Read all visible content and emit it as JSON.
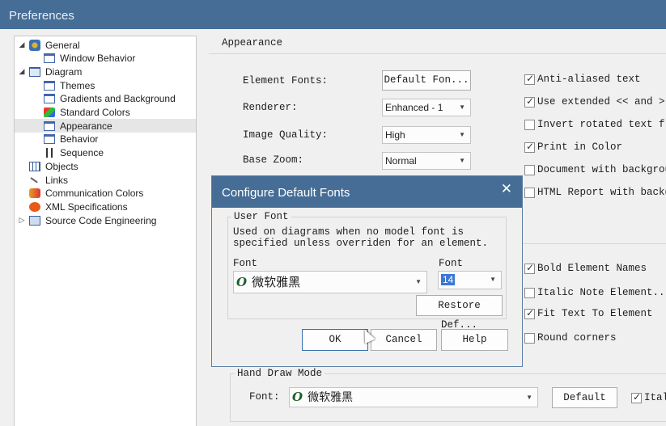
{
  "window": {
    "title": "Preferences"
  },
  "tree": [
    {
      "label": "General",
      "level": 0,
      "expander": "expanded",
      "icon": "gear-icon"
    },
    {
      "label": "Window Behavior",
      "level": 1,
      "icon": "window-icon"
    },
    {
      "label": "Diagram",
      "level": 0,
      "expander": "expanded",
      "icon": "folder-icon"
    },
    {
      "label": "Themes",
      "level": 1,
      "icon": "window-icon"
    },
    {
      "label": "Gradients and Background",
      "level": 1,
      "icon": "window-icon"
    },
    {
      "label": "Standard Colors",
      "level": 1,
      "icon": "colors-icon"
    },
    {
      "label": "Appearance",
      "level": 1,
      "icon": "window-icon",
      "selected": true
    },
    {
      "label": "Behavior",
      "level": 1,
      "icon": "window-icon"
    },
    {
      "label": "Sequence",
      "level": 1,
      "icon": "sequence-icon"
    },
    {
      "label": "Objects",
      "level": 0,
      "icon": "objects-icon"
    },
    {
      "label": "Links",
      "level": 0,
      "icon": "links-icon"
    },
    {
      "label": "Communication Colors",
      "level": 0,
      "icon": "communication-icon"
    },
    {
      "label": "XML Specifications",
      "level": 0,
      "icon": "xml-icon"
    },
    {
      "label": "Source Code Engineering",
      "level": 0,
      "expander": "collapsed",
      "icon": "source-code-icon"
    }
  ],
  "appearance": {
    "title": "Appearance",
    "element_fonts_label": "Element Fonts:",
    "element_fonts_button": "Default Fon...",
    "renderer_label": "Renderer:",
    "renderer_value": "Enhanced - 1",
    "image_quality_label": "Image Quality:",
    "image_quality_value": "High",
    "base_zoom_label": "Base Zoom:",
    "base_zoom_value": "Normal",
    "checks_top": [
      {
        "label": "Anti-aliased text",
        "checked": true
      },
      {
        "label": "Use extended << and >",
        "checked": true
      },
      {
        "label": "Invert rotated text f",
        "checked": false
      },
      {
        "label": "Print in Color",
        "checked": true
      },
      {
        "label": "Document with backgrou",
        "checked": false
      },
      {
        "label": "HTML Report with backg",
        "checked": false
      }
    ],
    "checks_bottom": [
      {
        "label": "Bold Element Names",
        "checked": true
      },
      {
        "label": "Italic Note Element...",
        "checked": false
      },
      {
        "label": "Fit Text To Element",
        "checked": true
      },
      {
        "label": "Round corners",
        "checked": false
      }
    ],
    "hand_draw": {
      "title": "Hand Draw Mode",
      "font_label": "Font:",
      "font_value": "微软雅黑",
      "default_button": "Default",
      "italic_label": "Ital",
      "italic_checked": true
    }
  },
  "dialog": {
    "title": "Configure Default Fonts",
    "group_title": "User Font",
    "description": "Used on diagrams when no model font is specified unless overriden for an element.",
    "font_label": "Font",
    "font_value": "微软雅黑",
    "size_label": "Font",
    "size_value": "14",
    "restore_button": "Restore Def...",
    "ok_button": "OK",
    "cancel_button": "Cancel",
    "help_button": "Help"
  }
}
